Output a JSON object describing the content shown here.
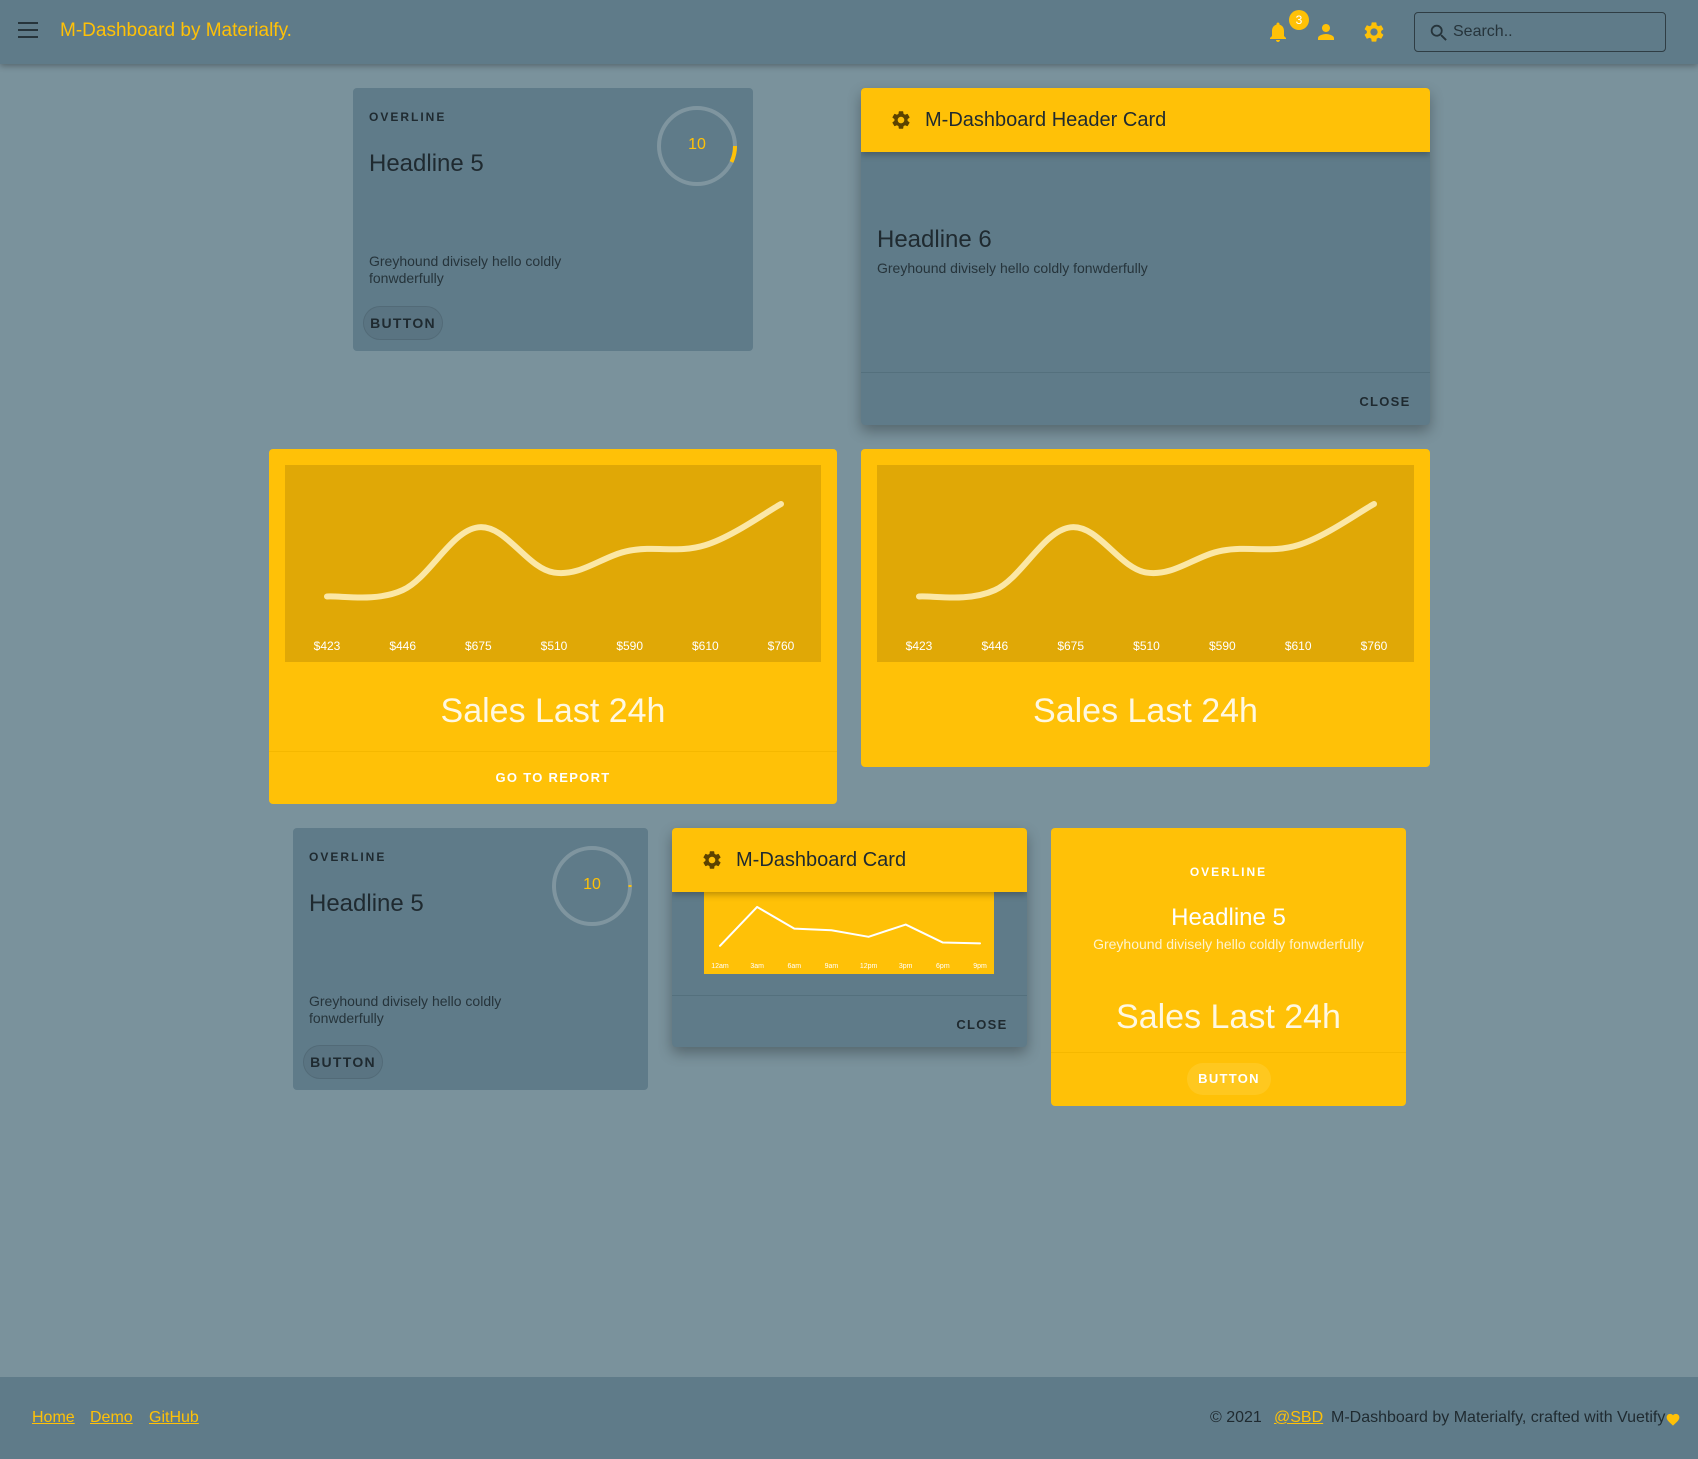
{
  "app": {
    "title": "M-Dashboard by Materialfy.",
    "notifications_count": "3",
    "search_placeholder": "Search..",
    "accent_color": "#ffc107"
  },
  "card1": {
    "overline": "OVERLINE",
    "headline": "Headline 5",
    "progress_value": "10",
    "text": "Greyhound divisely hello coldly fonwderfully",
    "button": "BUTTON"
  },
  "header_card": {
    "title": "M-Dashboard Header Card",
    "headline": "Headline 6",
    "text": "Greyhound divisely hello coldly fonwderfully",
    "close": "CLOSE"
  },
  "sales_card_1": {
    "title": "Sales Last 24h",
    "action": "GO TO REPORT"
  },
  "sales_card_2": {
    "title": "Sales Last 24h"
  },
  "card4": {
    "overline": "OVERLINE",
    "headline": "Headline 5",
    "progress_value": "10",
    "text": "Greyhound divisely hello coldly fonwderfully",
    "button": "BUTTON"
  },
  "mini_card": {
    "title": "M-Dashboard Card",
    "close": "CLOSE"
  },
  "yellow_card": {
    "overline": "OVERLINE",
    "headline": "Headline 5",
    "text": "Greyhound divisely hello coldly fonwderfully",
    "sales": "Sales Last 24h",
    "button": "BUTTON"
  },
  "footer": {
    "home": "Home",
    "demo": "Demo",
    "github": "GitHub",
    "copyright": "© 2021",
    "handle": "@SBD",
    "credit": "M-Dashboard by Materialfy, crafted with Vuetify"
  },
  "chart_data": [
    {
      "type": "line",
      "categories": [
        "$423",
        "$446",
        "$675",
        "$510",
        "$590",
        "$610",
        "$760"
      ],
      "values": [
        423,
        446,
        675,
        510,
        590,
        610,
        760
      ]
    },
    {
      "type": "line",
      "categories": [
        "$423",
        "$446",
        "$675",
        "$510",
        "$590",
        "$610",
        "$760"
      ],
      "values": [
        423,
        446,
        675,
        510,
        590,
        610,
        760
      ]
    },
    {
      "type": "line",
      "categories": [
        "12am",
        "3am",
        "6am",
        "9am",
        "12pm",
        "3pm",
        "6pm",
        "9pm"
      ],
      "values": [
        200,
        675,
        410,
        390,
        310,
        460,
        240,
        230
      ]
    }
  ]
}
